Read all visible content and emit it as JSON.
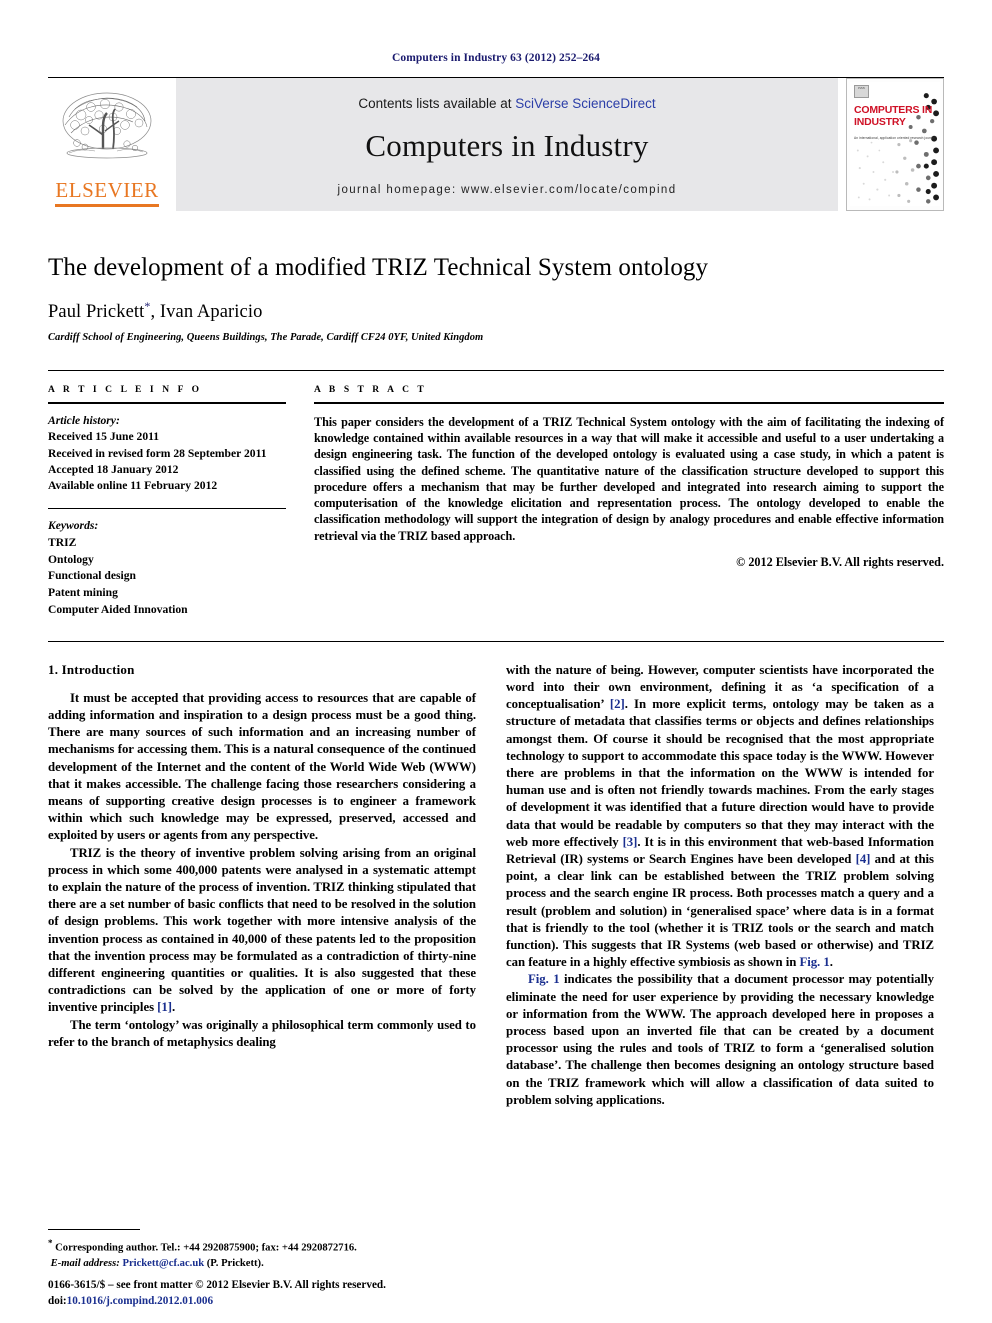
{
  "running_head": "Computers in Industry 63 (2012) 252–264",
  "masthead": {
    "contents_prefix": "Contents lists available at ",
    "contents_link": "SciVerse ScienceDirect",
    "journal_title": "Computers in Industry",
    "homepage": "journal homepage: www.elsevier.com/locate/compind",
    "publisher_wordmark": "ELSEVIER",
    "cover": {
      "badge": "ISSN",
      "title_line1": "COMPUTERS IN",
      "title_line2": "INDUSTRY",
      "subtitle": "An international, application oriented research journal"
    }
  },
  "article": {
    "title": "The development of a modified TRIZ Technical System ontology",
    "authors": "Paul Prickett",
    "authors_rest": ", Ivan Aparicio",
    "corresponding_marker": "*",
    "affiliation": "Cardiff School of Engineering, Queens Buildings, The Parade, Cardiff CF24 0YF, United Kingdom"
  },
  "article_info": {
    "heading": "A R T I C L E   I N F O",
    "history_label": "Article history:",
    "history": [
      "Received 15 June 2011",
      "Received in revised form 28 September 2011",
      "Accepted 18 January 2012",
      "Available online 11 February 2012"
    ],
    "keywords_label": "Keywords:",
    "keywords": [
      "TRIZ",
      "Ontology",
      "Functional design",
      "Patent mining",
      "Computer Aided Innovation"
    ]
  },
  "abstract": {
    "heading": "A B S T R A C T",
    "text": "This paper considers the development of a TRIZ Technical System ontology with the aim of facilitating the indexing of knowledge contained within available resources in a way that will make it accessible and useful to a user undertaking a design engineering task. The function of the developed ontology is evaluated using a case study, in which a patent is classified using the defined scheme. The quantitative nature of the classification structure developed to support this procedure offers a mechanism that may be further developed and integrated into research aiming to support the computerisation of the knowledge elicitation and representation process. The ontology developed to enable the classification methodology will support the integration of design by analogy procedures and enable effective information retrieval via the TRIZ based approach.",
    "copyright": "© 2012 Elsevier B.V. All rights reserved."
  },
  "body": {
    "section_heading": "1. Introduction",
    "left_paragraphs": [
      "It must be accepted that providing access to resources that are capable of adding information and inspiration to a design process must be a good thing. There are many sources of such information and an increasing number of mechanisms for accessing them. This is a natural consequence of the continued development of the Internet and the content of the World Wide Web (WWW) that it makes accessible. The challenge facing those researchers considering a means of supporting creative design processes is to engineer a framework within which such knowledge may be expressed, preserved, accessed and exploited by users or agents from any perspective.",
      "TRIZ is the theory of inventive problem solving arising from an original process in which some 400,000 patents were analysed in a systematic attempt to explain the nature of the process of invention. TRIZ thinking stipulated that there are a set number of basic conflicts that need to be resolved in the solution of design problems. This work together with more intensive analysis of the invention process as contained in 40,000 of these patents led to the proposition that the invention process may be formulated as a contradiction of thirty-nine different engineering quantities or qualities. It is also suggested that these contradictions can be solved by the application of one or more of forty inventive principles [1].",
      "The term ‘ontology’ was originally a philosophical term commonly used to refer to the branch of metaphysics dealing"
    ],
    "right_paragraphs": [
      "with the nature of being. However, computer scientists have incorporated the word into their own environment, defining it as ‘a specification of a conceptualisation’ [2]. In more explicit terms, ontology may be taken as a structure of metadata that classifies terms or objects and defines relationships amongst them. Of course it should be recognised that the most appropriate technology to support to accommodate this space today is the WWW. However there are problems in that the information on the WWW is intended for human use and is often not friendly towards machines. From the early stages of development it was identified that a future direction would have to provide data that would be readable by computers so that they may interact with the web more effectively [3]. It is in this environment that web-based Information Retrieval (IR) systems or Search Engines have been developed [4] and at this point, a clear link can be established between the TRIZ problem solving process and the search engine IR process. Both processes match a query and a result (problem and solution) in ‘generalised space’ where data is in a format that is friendly to the tool (whether it is TRIZ tools or the search and match function). This suggests that IR Systems (web based or otherwise) and TRIZ can feature in a highly effective symbiosis as shown in Fig. 1.",
      "Fig. 1 indicates the possibility that a document processor may potentially eliminate the need for user experience by providing the necessary knowledge or information from the WWW. The approach developed here in proposes a process based upon an inverted file that can be created by a document processor using the rules and tools of TRIZ to form a ‘generalised solution database’. The challenge then becomes designing an ontology structure based on the TRIZ framework which will allow a classification of data suited to problem solving applications."
    ]
  },
  "footnote": {
    "marker": "*",
    "text": "Corresponding author. Tel.: +44 2920875900; fax: +44 2920872716.",
    "email_label": "E-mail address:",
    "email": "Prickett@cf.ac.uk",
    "email_owner": "(P. Prickett)."
  },
  "footer": {
    "issn_line": "0166-3615/$ – see front matter © 2012 Elsevier B.V. All rights reserved.",
    "doi_prefix": "doi:",
    "doi": "10.1016/j.compind.2012.01.006"
  },
  "colors": {
    "link": "#2b3ea8",
    "citation": "#1a2f8f",
    "elsevier_orange": "#e87722",
    "cover_red": "#cf1126",
    "running_head": "#1a1a6e",
    "masthead_bg": "#e7e7e9"
  }
}
